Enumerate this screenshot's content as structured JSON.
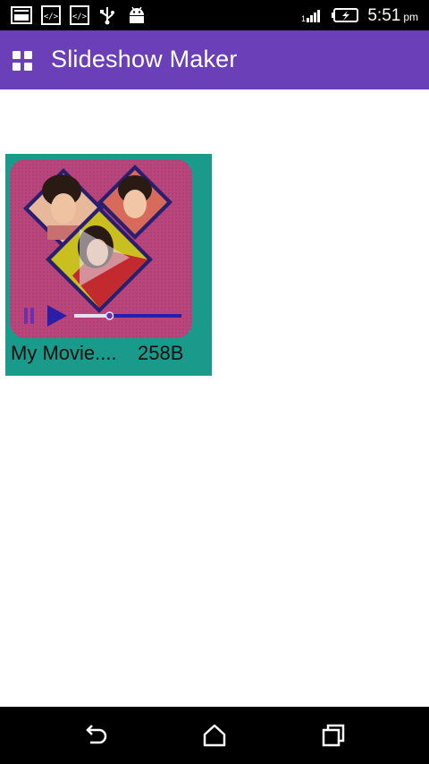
{
  "status_bar": {
    "time": "5:51",
    "ampm": "pm",
    "icons": [
      "gallery-icon",
      "code-icon",
      "code-icon",
      "usb-icon",
      "android-icon",
      "signal-icon",
      "battery-charging-icon"
    ]
  },
  "app_bar": {
    "title": "Slideshow Maker",
    "menu_icon": "grid-icon",
    "color": "#6a3fb8"
  },
  "videos": [
    {
      "name": "My Movie....",
      "size": "258B",
      "playback_progress": 0.33,
      "card_color": "#1a9a8a"
    }
  ],
  "nav_bar": {
    "icons": [
      "back-icon",
      "home-icon",
      "recents-icon"
    ]
  }
}
